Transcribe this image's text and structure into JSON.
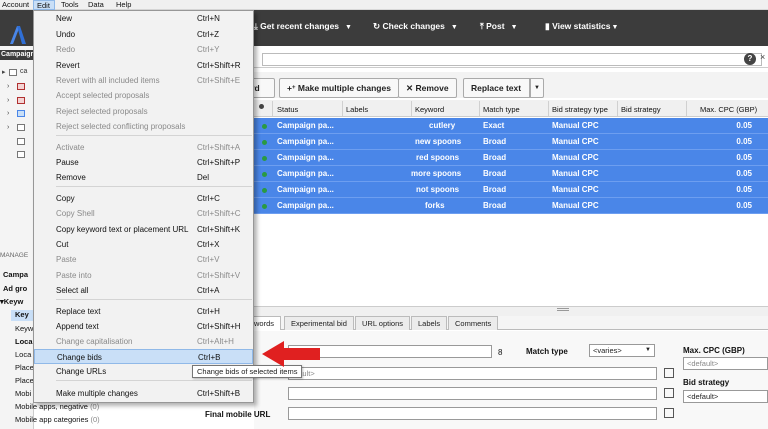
{
  "menubar": {
    "items": [
      "Account",
      "Edit",
      "Tools",
      "Data",
      "Help"
    ]
  },
  "toolbar": {
    "get_recent": "Get recent changes",
    "check": "Check changes",
    "post": "Post",
    "stats": "View statistics"
  },
  "left": {
    "campaign_header": "Campaign",
    "tree_label": "ca",
    "manage_label": "MANAGE",
    "items": [
      "Campa",
      "Ad gro",
      "Keyw",
      "Key",
      "Keyw",
      "Loca",
      "Loca",
      "Place",
      "Place",
      "Mobi",
      "Mobile apps, negative",
      "Mobile app categories"
    ],
    "counts": [
      "(0)",
      "(0)"
    ]
  },
  "actions": {
    "keyword_btn": "ord",
    "multi": "Make multiple changes",
    "remove": "Remove",
    "replace": "Replace text"
  },
  "grid": {
    "headers": [
      "Status",
      "Labels",
      "Keyword",
      "Match type",
      "Bid strategy type",
      "Bid strategy",
      "Max. CPC (GBP)"
    ],
    "rows": [
      {
        "campaign": "Campaign pa...",
        "keyword": "cutlery",
        "match": "Exact",
        "bst": "Manual CPC",
        "cpc": "0.05"
      },
      {
        "campaign": "Campaign pa...",
        "keyword": "new spoons",
        "match": "Broad",
        "bst": "Manual CPC",
        "cpc": "0.05"
      },
      {
        "campaign": "Campaign pa...",
        "keyword": "red spoons",
        "match": "Broad",
        "bst": "Manual CPC",
        "cpc": "0.05"
      },
      {
        "campaign": "Campaign pa...",
        "keyword": "more spoons",
        "match": "Broad",
        "bst": "Manual CPC",
        "cpc": "0.05"
      },
      {
        "campaign": "Campaign pa...",
        "keyword": "not spoons",
        "match": "Broad",
        "bst": "Manual CPC",
        "cpc": "0.05"
      },
      {
        "campaign": "Campaign pa...",
        "keyword": "forks",
        "match": "Broad",
        "bst": "Manual CPC",
        "cpc": "0.05"
      }
    ]
  },
  "tabs": [
    "words",
    "Experimental bid",
    "URL options",
    "Labels",
    "Comments"
  ],
  "editor": {
    "count": "8",
    "match_label": "Match type",
    "match_value": "<varies>",
    "default_short": "lt>",
    "default_url": "efault>",
    "final_mobile": "Final mobile URL",
    "maxcpc_label": "Max. CPC (GBP)",
    "maxcpc_placeholder": "<default>",
    "bidstrat_label": "Bid strategy",
    "bidstrat_value": "<default>"
  },
  "edit_menu": {
    "items": [
      {
        "label": "New",
        "shortcut": "Ctrl+N",
        "enabled": true
      },
      {
        "label": "Undo",
        "shortcut": "Ctrl+Z",
        "enabled": true
      },
      {
        "label": "Redo",
        "shortcut": "Ctrl+Y",
        "enabled": false
      },
      {
        "label": "Revert",
        "shortcut": "Ctrl+Shift+R",
        "enabled": true
      },
      {
        "label": "Revert with all included items",
        "shortcut": "Ctrl+Shift+E",
        "enabled": false
      },
      {
        "label": "Accept selected proposals",
        "shortcut": "",
        "enabled": false
      },
      {
        "label": "Reject selected proposals",
        "shortcut": "",
        "enabled": false
      },
      {
        "label": "Reject selected conflicting proposals",
        "shortcut": "",
        "enabled": false
      },
      {
        "label": "Activate",
        "shortcut": "Ctrl+Shift+A",
        "enabled": false
      },
      {
        "label": "Pause",
        "shortcut": "Ctrl+Shift+P",
        "enabled": true
      },
      {
        "label": "Remove",
        "shortcut": "Del",
        "enabled": true
      },
      {
        "label": "Copy",
        "shortcut": "Ctrl+C",
        "enabled": true
      },
      {
        "label": "Copy Shell",
        "shortcut": "Ctrl+Shift+C",
        "enabled": false
      },
      {
        "label": "Copy keyword text or placement URL",
        "shortcut": "Ctrl+Shift+K",
        "enabled": true
      },
      {
        "label": "Cut",
        "shortcut": "Ctrl+X",
        "enabled": true
      },
      {
        "label": "Paste",
        "shortcut": "Ctrl+V",
        "enabled": false
      },
      {
        "label": "Paste into",
        "shortcut": "Ctrl+Shift+V",
        "enabled": false
      },
      {
        "label": "Select all",
        "shortcut": "Ctrl+A",
        "enabled": true
      },
      {
        "label": "Replace text",
        "shortcut": "Ctrl+H",
        "enabled": true
      },
      {
        "label": "Append text",
        "shortcut": "Ctrl+Shift+H",
        "enabled": true
      },
      {
        "label": "Change capitalisation",
        "shortcut": "Ctrl+Alt+H",
        "enabled": false
      },
      {
        "label": "Change bids",
        "shortcut": "Ctrl+B",
        "enabled": true
      },
      {
        "label": "Change URLs",
        "shortcut": "",
        "enabled": true
      },
      {
        "label": "Make multiple changes",
        "shortcut": "Ctrl+Shift+B",
        "enabled": true
      }
    ]
  },
  "tooltip": "Change bids of selected items",
  "colors": {
    "accent": "#4a86e8",
    "toolbar": "#3c3c3c",
    "highlight": "#c9dff7",
    "arrow": "#e02020"
  }
}
